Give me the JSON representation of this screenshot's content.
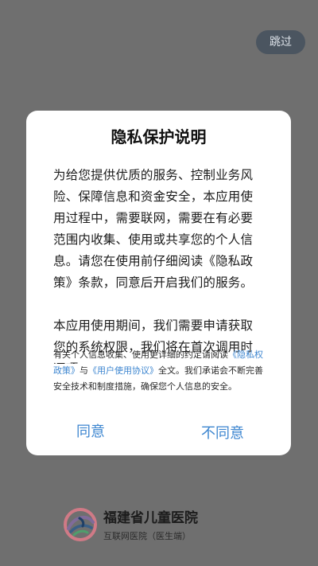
{
  "skip_label": "跳过",
  "dialog": {
    "title": "隐私保护说明",
    "paragraph1": "为给您提供优质的服务、控制业务风险、保障信息和资金安全，本应用使用过程中，需要联网，需要在有必要范围内收集、使用或共享您的个人信息。请您在使用前仔细阅读《隐私政策》条款，同意后开启我们的服务。",
    "paragraph2": "本应用使用期间，我们需要申请获取您的系统权限，我们将在首次调用时逐项",
    "note": {
      "part1": "有关个人信息收集、使用更详细的约定请阅读",
      "privacy_link": "《隐私权政策》",
      "part2": "与",
      "agreement_link": "《用户使用协议》",
      "part3": "全文。我们承诺会不断完善安全技术和制度措施，确保您个人信息的安全。"
    },
    "agree_label": "同意",
    "disagree_label": "不同意"
  },
  "brand": {
    "name": "福建省儿童医院",
    "subtitle": "互联网医院（医生端）"
  },
  "colors": {
    "overlay": "#6f6f6f",
    "link": "#3d86d0",
    "skip_bg": "#4b5560"
  }
}
